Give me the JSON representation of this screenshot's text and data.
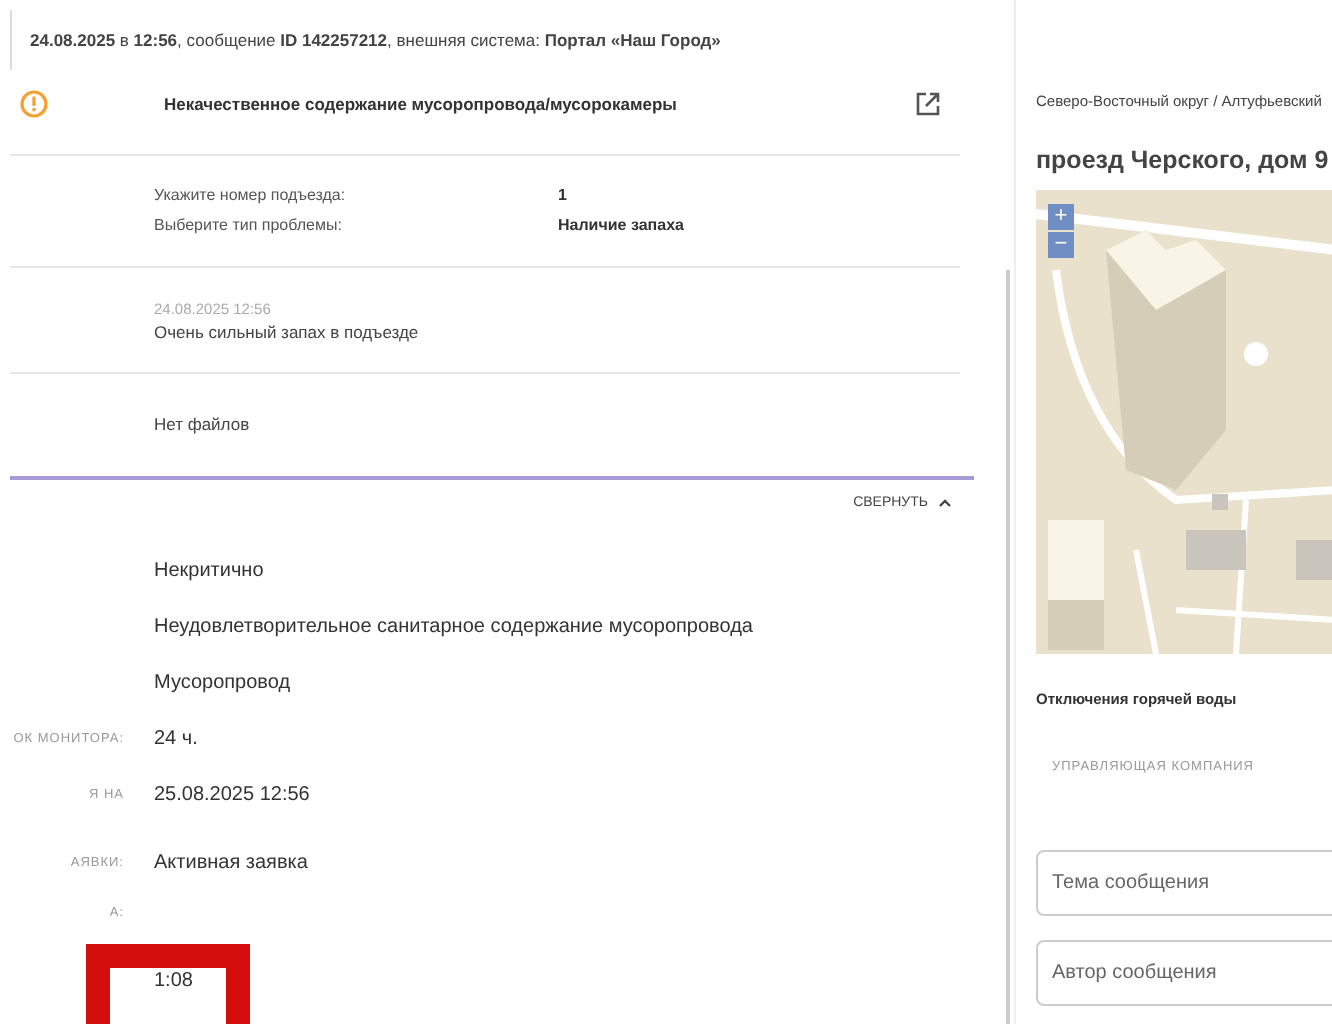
{
  "top_bar": {
    "text": "**24.08.2025** в **12:56**, сообщение **ID 142257212**, внешняя система: **Портал «Наш Город»**"
  },
  "issue": {
    "title": "Некачественное содержание мусоропровода/мусорокамеры",
    "fields": [
      {
        "label": "Укажите номер подъезда:",
        "value": "1"
      },
      {
        "label": "Выберите тип проблемы:",
        "value": "Наличие запаха"
      }
    ],
    "comment": {
      "date": "24.08.2025 12:56",
      "text": "Очень сильный запах в подъезде"
    },
    "files": "Нет файлов"
  },
  "collapse_button": "СВЕРНУТЬ",
  "details": [
    {
      "value": "Некритично"
    },
    {
      "value": "Неудовлетворительное санитарное содержание мусоропровода"
    },
    {
      "value": "Мусоропровод"
    },
    {
      "label": "ОК МОНИТОРА:",
      "value": "24 ч."
    },
    {
      "label": "Я НА",
      "value": "25.08.2025 12:56"
    },
    {
      "label": "АЯВКИ:",
      "value": "Активная заявка"
    },
    {
      "label": "А:"
    },
    {
      "value": "1:08"
    }
  ],
  "right_panel": {
    "breadcrumb": "Северо-Восточный округ / Алтуфьевский",
    "address": "проезд Черского, дом 9",
    "zoom_in": "+",
    "zoom_out": "−",
    "section_title": "Отключения горячей воды",
    "column_header": "УПРАВЛЯЮЩАЯ КОМПАНИЯ",
    "inputs": [
      {
        "placeholder": "Тема сообщения"
      },
      {
        "placeholder": "Автор сообщения"
      }
    ]
  }
}
